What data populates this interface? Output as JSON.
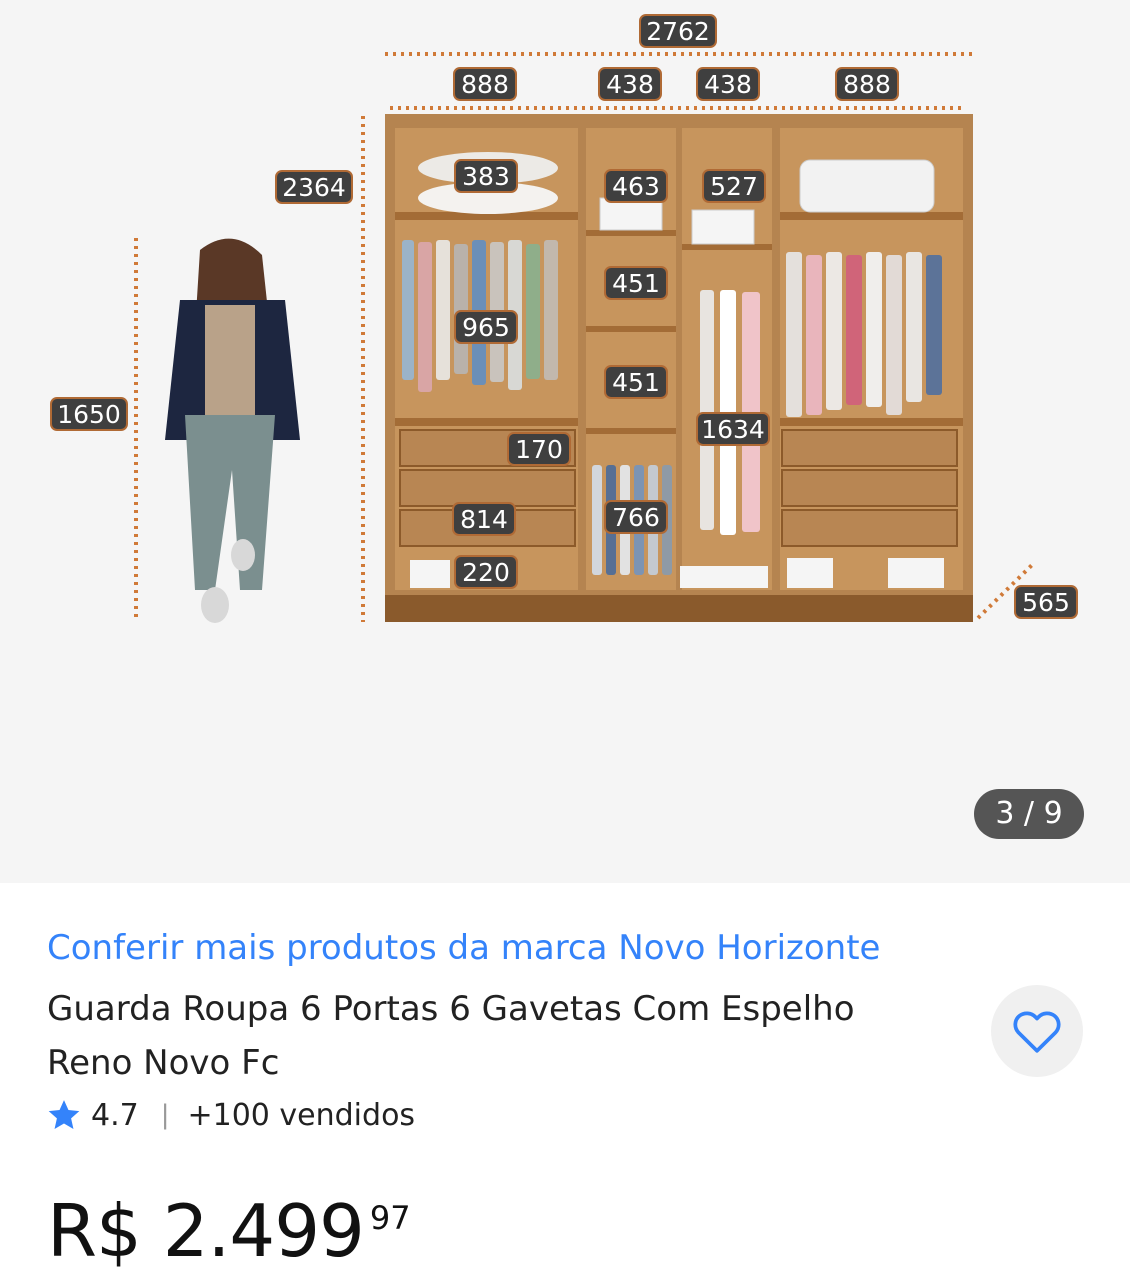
{
  "gallery": {
    "image_alt": "Guarda roupa com dimensões",
    "counter": "3 / 9",
    "dimensions": {
      "total_width": "2762",
      "left_door": "888",
      "center_left_door": "438",
      "center_right_door": "438",
      "right_door": "888",
      "height": "2364",
      "person_height": "1650",
      "top_shelf_left": "383",
      "hanger_left": "965",
      "drawer_height": "170",
      "drawer_width": "814",
      "bottom_niche": "220",
      "top_niche_center": "463",
      "center_niche_1": "451",
      "center_niche_2": "451",
      "center_hanger": "766",
      "top_niche_right": "527",
      "long_hanger": "1634",
      "depth": "565"
    }
  },
  "product": {
    "brand_link": "Conferir mais produtos da marca Novo Horizonte",
    "title": "Guarda Roupa 6 Portas 6 Gavetas Com Espelho Reno Novo Fc",
    "rating": "4.7",
    "separator": "|",
    "sold": "+100 vendidos",
    "price_main": "R$ 2.499",
    "price_cents": "97"
  },
  "icons": {
    "favorite": "heart-icon",
    "rating": "star-icon"
  },
  "colors": {
    "link": "#3483fa",
    "star": "#3483fa",
    "dimension_dots": "#d07a38"
  }
}
